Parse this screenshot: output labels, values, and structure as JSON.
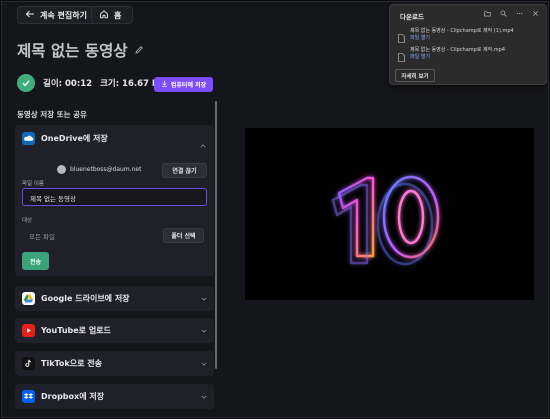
{
  "topbar": {
    "back_label": "계속 편집하기",
    "home_label": "홈"
  },
  "video": {
    "title": "제목 없는 동영상",
    "length_text": "길이: 00:12",
    "size_text": "크기: 16.67 MB",
    "save_to_pc_label": "컴퓨터에 저장"
  },
  "share": {
    "section_label": "동영상 저장 또는 공유",
    "onedrive": {
      "title": "OneDrive에 저장",
      "account_email": "bluenetboss@daum.net",
      "disconnect_label": "연결 끊기",
      "filename_label": "파일 이름",
      "filename_value": "제목 없는 동영상",
      "destination_label": "대상",
      "destination_value": "모든 파일",
      "choose_folder_label": "폴더 선택",
      "send_label": "전송"
    },
    "services": [
      {
        "label": "Google 드라이브에 저장",
        "icon": "google-drive-icon"
      },
      {
        "label": "YouTube로 업로드",
        "icon": "youtube-icon"
      },
      {
        "label": "TikTok으로 전송",
        "icon": "tiktok-icon"
      },
      {
        "label": "Dropbox에 저장",
        "icon": "dropbox-icon"
      }
    ]
  },
  "downloads": {
    "title": "다운로드",
    "items": [
      {
        "name": "제목 없는 동영상 - Clipchamp로 제작 (1).mp4",
        "link": "파일 열기"
      },
      {
        "name": "제목 없는 동영상 - Clipchamp로 제작.mp4",
        "link": "파일 열기"
      }
    ],
    "more_label": "자세히 보기"
  },
  "colors": {
    "accent": "#7b4dff",
    "success": "#3fae7d",
    "onedrive": "#0f6cbd",
    "youtube": "#e62117",
    "dropbox": "#0061fe"
  }
}
